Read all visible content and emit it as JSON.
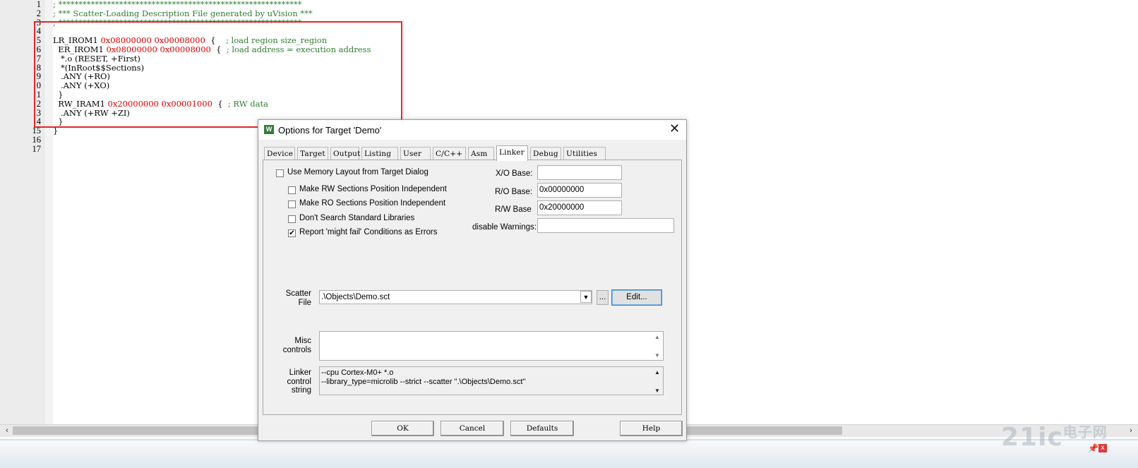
{
  "editor": {
    "line_numbers": [
      "1",
      "2",
      "3",
      "4",
      "5",
      "6",
      "7",
      "8",
      "9",
      "0",
      "1",
      "2",
      "3",
      "4",
      "15",
      "16",
      "17"
    ],
    "lines": [
      [
        {
          "t": "; ************************************************************",
          "c": "comment"
        }
      ],
      [
        {
          "t": "; *** Scatter-Loading Description File generated by uVision ***",
          "c": "comment"
        }
      ],
      [
        {
          "t": "; ************************************************************",
          "c": "comment"
        }
      ],
      [],
      [
        {
          "t": "LR_IROM1 ",
          "c": ""
        },
        {
          "t": "0x08000000",
          "c": "hex"
        },
        {
          "t": " ",
          "c": ""
        },
        {
          "t": "0x00008000",
          "c": "hex"
        },
        {
          "t": "  {    ",
          "c": ""
        },
        {
          "t": "; load region size_region",
          "c": "comment"
        }
      ],
      [
        {
          "t": "  ER_IROM1 ",
          "c": ""
        },
        {
          "t": "0x08000000",
          "c": "hex"
        },
        {
          "t": " ",
          "c": ""
        },
        {
          "t": "0x00008000",
          "c": "hex"
        },
        {
          "t": "  {  ",
          "c": ""
        },
        {
          "t": "; load address = execution address",
          "c": "comment"
        }
      ],
      [
        {
          "t": "   *.o (RESET, +First)",
          "c": ""
        }
      ],
      [
        {
          "t": "   *(InRoot$$Sections)",
          "c": ""
        }
      ],
      [
        {
          "t": "   .ANY (+RO)",
          "c": ""
        }
      ],
      [
        {
          "t": "   .ANY (+XO)",
          "c": ""
        }
      ],
      [
        {
          "t": "  }",
          "c": ""
        }
      ],
      [
        {
          "t": "  RW_IRAM1 ",
          "c": ""
        },
        {
          "t": "0x20000000",
          "c": "hex"
        },
        {
          "t": " ",
          "c": ""
        },
        {
          "t": "0x00001000",
          "c": "hex"
        },
        {
          "t": "  {  ",
          "c": ""
        },
        {
          "t": "; RW data",
          "c": "comment"
        }
      ],
      [
        {
          "t": "   .ANY (+RW +ZI)",
          "c": ""
        }
      ],
      [
        {
          "t": "  }",
          "c": ""
        }
      ],
      [
        {
          "t": "}",
          "c": ""
        }
      ],
      [],
      []
    ]
  },
  "watermark": {
    "main": "21ic",
    "sub": "电子网"
  },
  "dialog": {
    "title": "Options for Target 'Demo'",
    "tabs": [
      "Device",
      "Target",
      "Output",
      "Listing",
      "User",
      "C/C++",
      "Asm",
      "Linker",
      "Debug",
      "Utilities"
    ],
    "active_tab": "Linker",
    "use_memory_layout": {
      "label": "Use Memory Layout from Target Dialog",
      "checked": false
    },
    "options": [
      {
        "label": "Make RW Sections Position Independent",
        "checked": false
      },
      {
        "label": "Make RO Sections Position Independent",
        "checked": false
      },
      {
        "label": "Don't Search Standard Libraries",
        "checked": false
      },
      {
        "label": "Report 'might fail' Conditions as Errors",
        "checked": true
      }
    ],
    "xo_base": {
      "label": "X/O Base:",
      "value": ""
    },
    "ro_base": {
      "label": "R/O Base:",
      "value": "0x00000000"
    },
    "rw_base": {
      "label": "R/W Base",
      "value": "0x20000000"
    },
    "disable_warnings": {
      "label": "disable Warnings:",
      "value": ""
    },
    "scatter_file": {
      "label_line1": "Scatter",
      "label_line2": "File",
      "value": ".\\Objects\\Demo.sct",
      "browse_label": "...",
      "edit_label": "Edit..."
    },
    "misc_controls": {
      "label_line1": "Misc",
      "label_line2": "controls",
      "value": ""
    },
    "linker_control": {
      "label_line1": "Linker",
      "label_line2": "control",
      "label_line3": "string",
      "line1": "--cpu Cortex-M0+ *.o",
      "line2": "--library_type=microlib --strict --scatter \".\\Objects\\Demo.sct\""
    },
    "buttons": {
      "ok": "OK",
      "cancel": "Cancel",
      "defaults": "Defaults",
      "help": "Help"
    }
  }
}
